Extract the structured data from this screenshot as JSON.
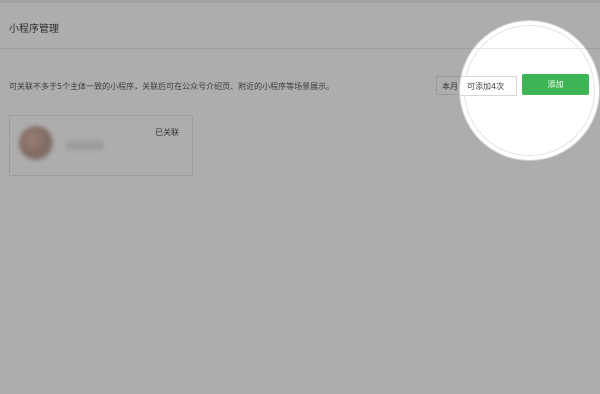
{
  "page": {
    "title": "小程序管理",
    "description": "可关联不多于5个主体一致的小程序，关联后可在公众号介绍页、附近的小程序等场景展示。"
  },
  "toolbar": {
    "quota_prefix": "本月",
    "quota_text": "可添加4次",
    "add_label": "添加",
    "accent_color": "#3db555"
  },
  "mini_programs": [
    {
      "status": "已关联"
    }
  ]
}
